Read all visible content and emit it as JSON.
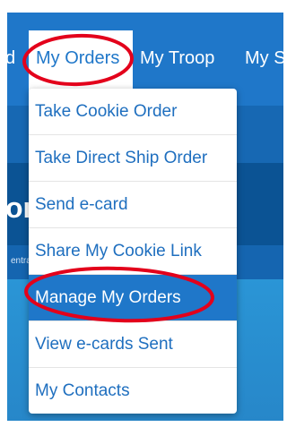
{
  "navbar": {
    "items": [
      {
        "label": "d"
      },
      {
        "label": "My Orders"
      },
      {
        "label": "My Troop"
      },
      {
        "label": "My S"
      }
    ],
    "active_item": "My Orders"
  },
  "hero": {
    "title_fragment": "or"
  },
  "subbar": {
    "text_fragment": "entra"
  },
  "dropdown": {
    "items": [
      {
        "label": "Take Cookie Order"
      },
      {
        "label": "Take Direct Ship Order"
      },
      {
        "label": "Send e-card"
      },
      {
        "label": "Share My Cookie Link"
      },
      {
        "label": "Manage My Orders"
      },
      {
        "label": "View e-cards Sent"
      },
      {
        "label": "My Contacts"
      }
    ],
    "highlighted_item": "Manage My Orders"
  },
  "colors": {
    "nav_blue": "#1f77c9",
    "hero_blue": "#0b5394",
    "annotation_red": "#e3001b",
    "menu_text_blue": "#1f6fbf"
  }
}
